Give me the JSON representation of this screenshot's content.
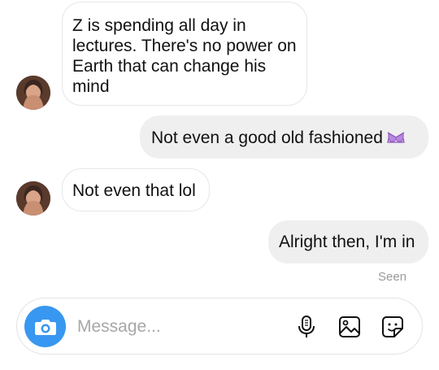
{
  "messages": [
    {
      "direction": "incoming",
      "text": "Z is spending all day in lectures. There's no power on Earth that can change his mind"
    },
    {
      "direction": "outgoing",
      "text": "Not even a good old fashioned",
      "emoji": "bra-emoji"
    },
    {
      "direction": "incoming",
      "text": "Not even that lol"
    },
    {
      "direction": "outgoing",
      "text": "Alright then, I'm in"
    }
  ],
  "status": {
    "seen_label": "Seen"
  },
  "composer": {
    "placeholder": "Message..."
  },
  "icons": {
    "camera": "camera-icon",
    "mic": "microphone-icon",
    "gallery": "image-gallery-icon",
    "sticker": "sticker-icon"
  },
  "colors": {
    "accent": "#3897f0",
    "outgoing_bubble": "#efefef",
    "incoming_border": "#e6e6e6",
    "emoji": "#a66fd1"
  }
}
